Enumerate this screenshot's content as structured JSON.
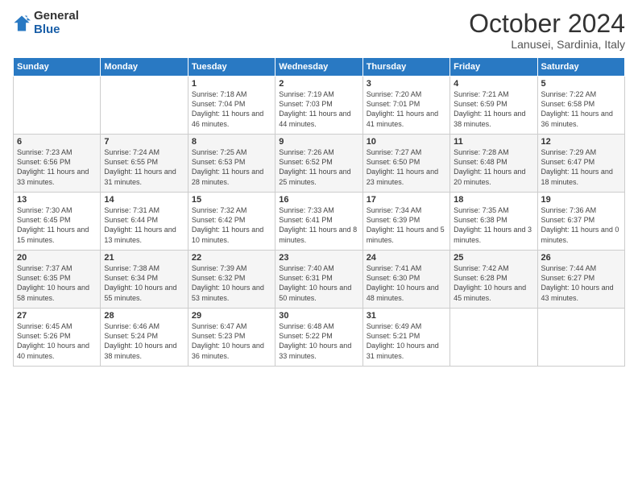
{
  "logo": {
    "general": "General",
    "blue": "Blue"
  },
  "title": "October 2024",
  "subtitle": "Lanusei, Sardinia, Italy",
  "days_of_week": [
    "Sunday",
    "Monday",
    "Tuesday",
    "Wednesday",
    "Thursday",
    "Friday",
    "Saturday"
  ],
  "weeks": [
    [
      {
        "day": "",
        "sunrise": "",
        "sunset": "",
        "daylight": ""
      },
      {
        "day": "",
        "sunrise": "",
        "sunset": "",
        "daylight": ""
      },
      {
        "day": "1",
        "sunrise": "Sunrise: 7:18 AM",
        "sunset": "Sunset: 7:04 PM",
        "daylight": "Daylight: 11 hours and 46 minutes."
      },
      {
        "day": "2",
        "sunrise": "Sunrise: 7:19 AM",
        "sunset": "Sunset: 7:03 PM",
        "daylight": "Daylight: 11 hours and 44 minutes."
      },
      {
        "day": "3",
        "sunrise": "Sunrise: 7:20 AM",
        "sunset": "Sunset: 7:01 PM",
        "daylight": "Daylight: 11 hours and 41 minutes."
      },
      {
        "day": "4",
        "sunrise": "Sunrise: 7:21 AM",
        "sunset": "Sunset: 6:59 PM",
        "daylight": "Daylight: 11 hours and 38 minutes."
      },
      {
        "day": "5",
        "sunrise": "Sunrise: 7:22 AM",
        "sunset": "Sunset: 6:58 PM",
        "daylight": "Daylight: 11 hours and 36 minutes."
      }
    ],
    [
      {
        "day": "6",
        "sunrise": "Sunrise: 7:23 AM",
        "sunset": "Sunset: 6:56 PM",
        "daylight": "Daylight: 11 hours and 33 minutes."
      },
      {
        "day": "7",
        "sunrise": "Sunrise: 7:24 AM",
        "sunset": "Sunset: 6:55 PM",
        "daylight": "Daylight: 11 hours and 31 minutes."
      },
      {
        "day": "8",
        "sunrise": "Sunrise: 7:25 AM",
        "sunset": "Sunset: 6:53 PM",
        "daylight": "Daylight: 11 hours and 28 minutes."
      },
      {
        "day": "9",
        "sunrise": "Sunrise: 7:26 AM",
        "sunset": "Sunset: 6:52 PM",
        "daylight": "Daylight: 11 hours and 25 minutes."
      },
      {
        "day": "10",
        "sunrise": "Sunrise: 7:27 AM",
        "sunset": "Sunset: 6:50 PM",
        "daylight": "Daylight: 11 hours and 23 minutes."
      },
      {
        "day": "11",
        "sunrise": "Sunrise: 7:28 AM",
        "sunset": "Sunset: 6:48 PM",
        "daylight": "Daylight: 11 hours and 20 minutes."
      },
      {
        "day": "12",
        "sunrise": "Sunrise: 7:29 AM",
        "sunset": "Sunset: 6:47 PM",
        "daylight": "Daylight: 11 hours and 18 minutes."
      }
    ],
    [
      {
        "day": "13",
        "sunrise": "Sunrise: 7:30 AM",
        "sunset": "Sunset: 6:45 PM",
        "daylight": "Daylight: 11 hours and 15 minutes."
      },
      {
        "day": "14",
        "sunrise": "Sunrise: 7:31 AM",
        "sunset": "Sunset: 6:44 PM",
        "daylight": "Daylight: 11 hours and 13 minutes."
      },
      {
        "day": "15",
        "sunrise": "Sunrise: 7:32 AM",
        "sunset": "Sunset: 6:42 PM",
        "daylight": "Daylight: 11 hours and 10 minutes."
      },
      {
        "day": "16",
        "sunrise": "Sunrise: 7:33 AM",
        "sunset": "Sunset: 6:41 PM",
        "daylight": "Daylight: 11 hours and 8 minutes."
      },
      {
        "day": "17",
        "sunrise": "Sunrise: 7:34 AM",
        "sunset": "Sunset: 6:39 PM",
        "daylight": "Daylight: 11 hours and 5 minutes."
      },
      {
        "day": "18",
        "sunrise": "Sunrise: 7:35 AM",
        "sunset": "Sunset: 6:38 PM",
        "daylight": "Daylight: 11 hours and 3 minutes."
      },
      {
        "day": "19",
        "sunrise": "Sunrise: 7:36 AM",
        "sunset": "Sunset: 6:37 PM",
        "daylight": "Daylight: 11 hours and 0 minutes."
      }
    ],
    [
      {
        "day": "20",
        "sunrise": "Sunrise: 7:37 AM",
        "sunset": "Sunset: 6:35 PM",
        "daylight": "Daylight: 10 hours and 58 minutes."
      },
      {
        "day": "21",
        "sunrise": "Sunrise: 7:38 AM",
        "sunset": "Sunset: 6:34 PM",
        "daylight": "Daylight: 10 hours and 55 minutes."
      },
      {
        "day": "22",
        "sunrise": "Sunrise: 7:39 AM",
        "sunset": "Sunset: 6:32 PM",
        "daylight": "Daylight: 10 hours and 53 minutes."
      },
      {
        "day": "23",
        "sunrise": "Sunrise: 7:40 AM",
        "sunset": "Sunset: 6:31 PM",
        "daylight": "Daylight: 10 hours and 50 minutes."
      },
      {
        "day": "24",
        "sunrise": "Sunrise: 7:41 AM",
        "sunset": "Sunset: 6:30 PM",
        "daylight": "Daylight: 10 hours and 48 minutes."
      },
      {
        "day": "25",
        "sunrise": "Sunrise: 7:42 AM",
        "sunset": "Sunset: 6:28 PM",
        "daylight": "Daylight: 10 hours and 45 minutes."
      },
      {
        "day": "26",
        "sunrise": "Sunrise: 7:44 AM",
        "sunset": "Sunset: 6:27 PM",
        "daylight": "Daylight: 10 hours and 43 minutes."
      }
    ],
    [
      {
        "day": "27",
        "sunrise": "Sunrise: 6:45 AM",
        "sunset": "Sunset: 5:26 PM",
        "daylight": "Daylight: 10 hours and 40 minutes."
      },
      {
        "day": "28",
        "sunrise": "Sunrise: 6:46 AM",
        "sunset": "Sunset: 5:24 PM",
        "daylight": "Daylight: 10 hours and 38 minutes."
      },
      {
        "day": "29",
        "sunrise": "Sunrise: 6:47 AM",
        "sunset": "Sunset: 5:23 PM",
        "daylight": "Daylight: 10 hours and 36 minutes."
      },
      {
        "day": "30",
        "sunrise": "Sunrise: 6:48 AM",
        "sunset": "Sunset: 5:22 PM",
        "daylight": "Daylight: 10 hours and 33 minutes."
      },
      {
        "day": "31",
        "sunrise": "Sunrise: 6:49 AM",
        "sunset": "Sunset: 5:21 PM",
        "daylight": "Daylight: 10 hours and 31 minutes."
      },
      {
        "day": "",
        "sunrise": "",
        "sunset": "",
        "daylight": ""
      },
      {
        "day": "",
        "sunrise": "",
        "sunset": "",
        "daylight": ""
      }
    ]
  ]
}
